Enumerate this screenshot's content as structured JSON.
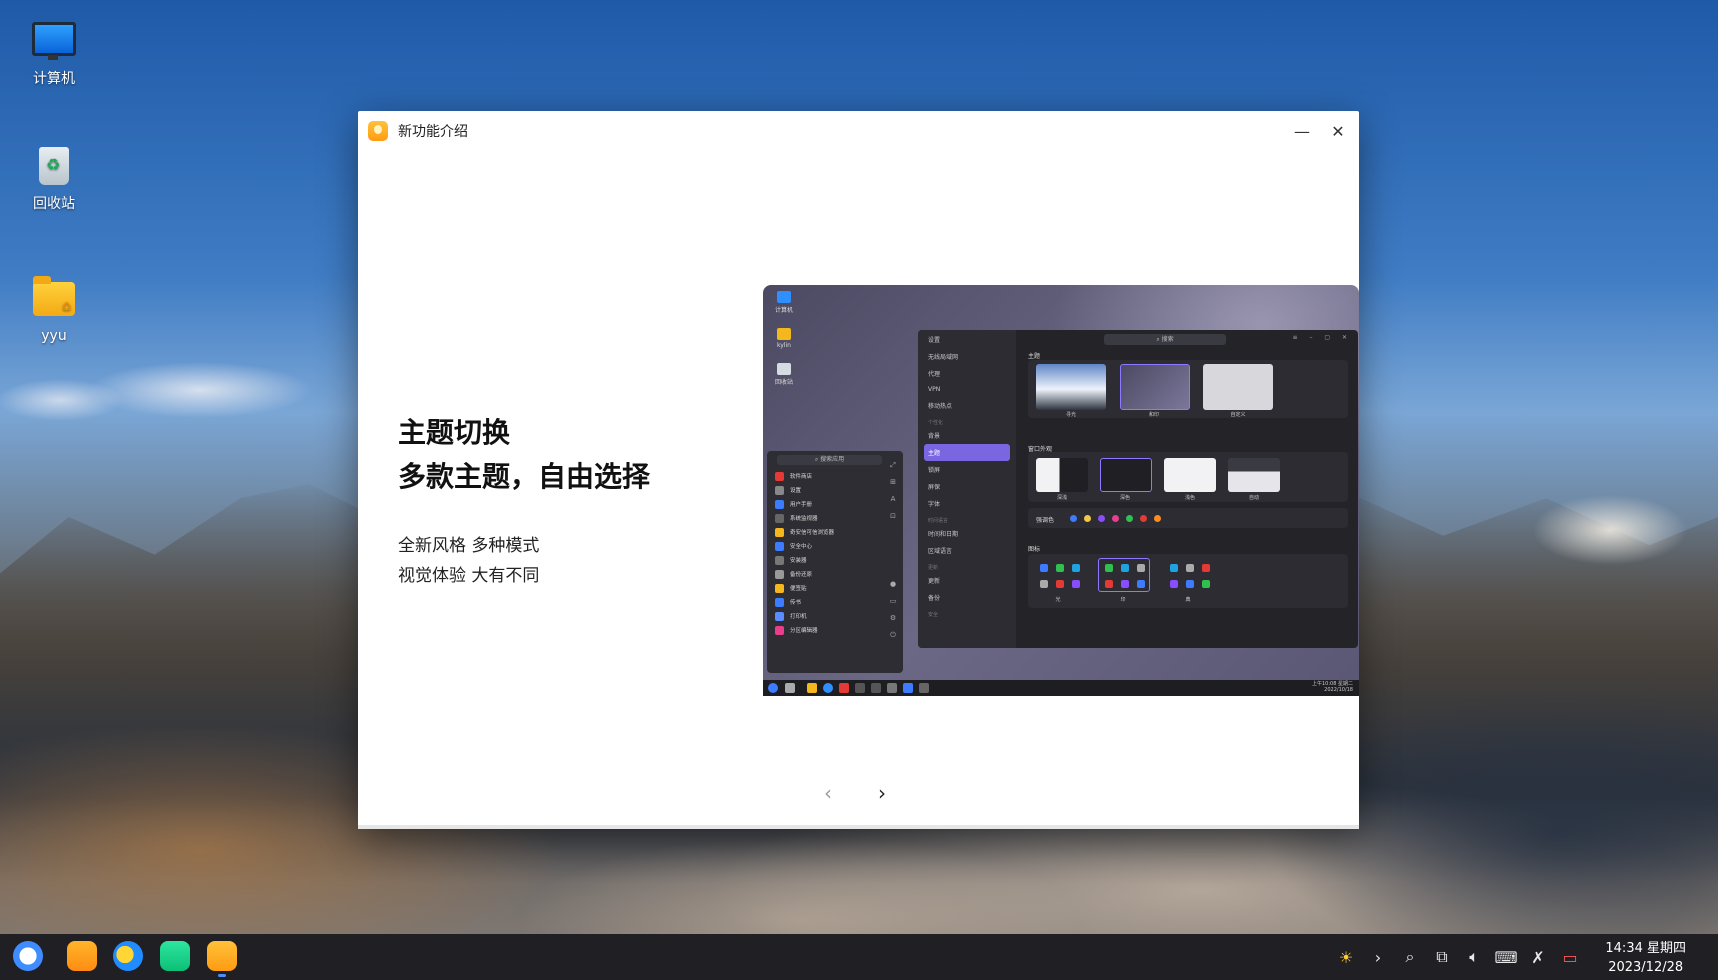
{
  "desktop": {
    "icons": [
      {
        "label": "计算机",
        "icon": "computer-icon"
      },
      {
        "label": "回收站",
        "icon": "trash-icon"
      },
      {
        "label": "yyu",
        "icon": "home-folder-icon"
      }
    ]
  },
  "window": {
    "title": "新功能介绍",
    "minimize_glyph": "—",
    "close_glyph": "✕",
    "feature": {
      "title_line1": "主题切换",
      "title_line2": "多款主题，自由选择",
      "desc_line1": "全新风格 多种模式",
      "desc_line2": "视觉体验 大有不同"
    },
    "nav": {
      "prev_glyph": "‹",
      "next_glyph": "›"
    }
  },
  "preview": {
    "desktop_icons": [
      "计算机",
      "kylin",
      "回收站"
    ],
    "settings": {
      "title": "设置",
      "search": "搜索",
      "sidebar": [
        {
          "label": "无线局域网"
        },
        {
          "label": "代理"
        },
        {
          "label": "VPN"
        },
        {
          "label": "移动热点"
        },
        {
          "head": "个性化"
        },
        {
          "label": "背景"
        },
        {
          "label": "主题",
          "active": true
        },
        {
          "label": "锁屏"
        },
        {
          "label": "屏保"
        },
        {
          "label": "字体"
        },
        {
          "head": "时间语言"
        },
        {
          "label": "时间和日期"
        },
        {
          "label": "区域语言"
        },
        {
          "head": "更新"
        },
        {
          "label": "更新"
        },
        {
          "label": "备份"
        },
        {
          "head": "安全"
        }
      ],
      "sections": {
        "theme": "主题",
        "window": "窗口外观",
        "accent": "强调色",
        "icons": "图标"
      },
      "themes": [
        "寻光",
        "和印",
        "自定义"
      ],
      "window_styles": [
        "深浅",
        "深色",
        "浅色",
        "自动"
      ],
      "icon_sets": [
        "光",
        "印",
        "典"
      ],
      "accent_colors": [
        "#3d7bff",
        "#f5c842",
        "#8a4cff",
        "#e83e8c",
        "#30c04f",
        "#e53935",
        "#ff8c1a"
      ]
    },
    "menu": {
      "search": "搜索应用",
      "items": [
        "软件商店",
        "设置",
        "用户手册",
        "系统监视器",
        "奇安信可信浏览器",
        "安全中心",
        "安装器",
        "备份还原",
        "便签贴",
        "传书",
        "打印机",
        "分区编辑器"
      ]
    },
    "taskbar_time": [
      "上午10:08 星期二",
      "2022/10/18"
    ]
  },
  "taskbar": {
    "clock_time": "14:34 星期四",
    "clock_date": "2023/12/28",
    "tray_icons": [
      "brightness-icon",
      "chevron-right-icon",
      "search-icon",
      "network-icon",
      "volume-icon",
      "keyboard-icon",
      "bluetooth-off-icon",
      "notification-icon"
    ]
  }
}
